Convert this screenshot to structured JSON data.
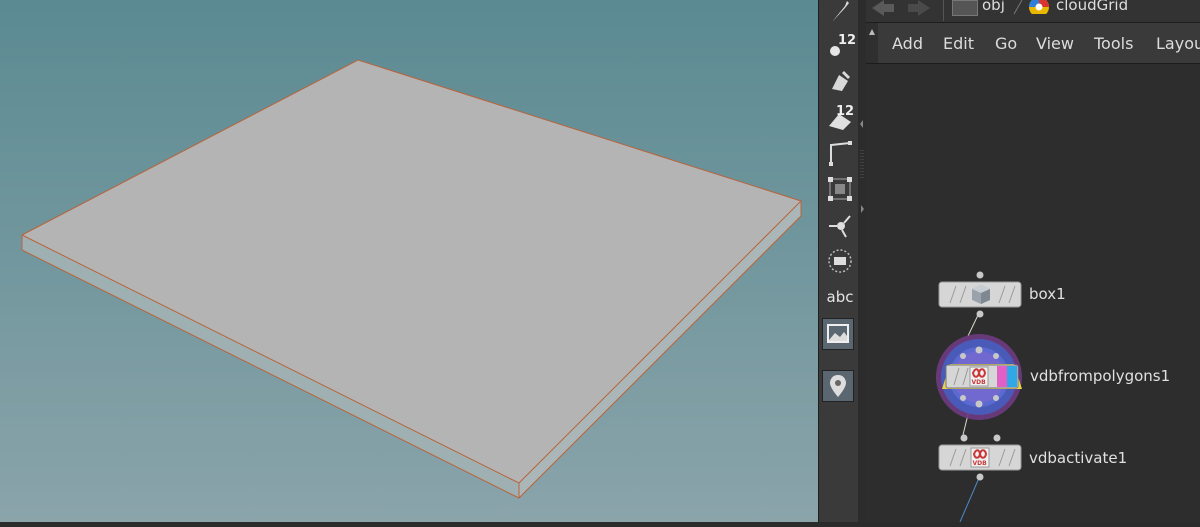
{
  "viewport": {
    "background_top": "#5a8890",
    "background_bottom": "#86a2a8",
    "object_color": "#b6b6b6",
    "wire_color": "#b8603a"
  },
  "toolbar": {
    "tools": [
      {
        "name": "select-tool-icon"
      },
      {
        "name": "point-number-icon",
        "badge": "12"
      },
      {
        "name": "paint-icon"
      },
      {
        "name": "primitive-number-icon",
        "badge": "12"
      },
      {
        "name": "edge-tool-icon"
      },
      {
        "name": "snap-grid-icon"
      },
      {
        "name": "handle-tool-icon"
      },
      {
        "name": "display-option-icon"
      },
      {
        "name": "text-tool-icon",
        "label": "abc"
      },
      {
        "name": "background-image-icon",
        "active": true
      },
      {
        "name": "pin-icon",
        "active": true
      }
    ]
  },
  "network": {
    "path": {
      "obj": "obj",
      "node": "cloudGrid"
    },
    "menu": [
      "Add",
      "Edit",
      "Go",
      "View",
      "Tools",
      "Layou"
    ],
    "nodes": [
      {
        "name": "box1"
      },
      {
        "name": "vdbfrompolygons1",
        "selected": true
      },
      {
        "name": "vdbactivate1"
      }
    ],
    "vdb_badge": "VDB"
  }
}
